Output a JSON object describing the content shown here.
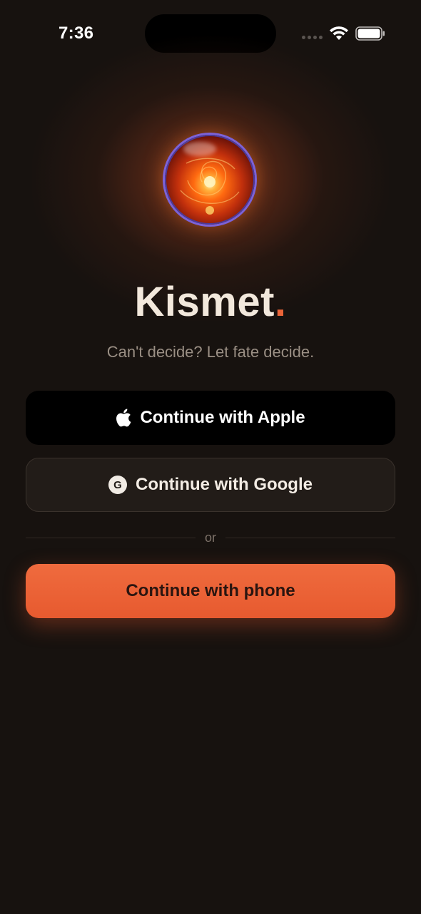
{
  "status_bar": {
    "time": "7:36"
  },
  "app": {
    "name": "Kismet",
    "name_dot": ".",
    "tagline": "Can't decide? Let fate decide."
  },
  "auth": {
    "apple_label": "Continue with Apple",
    "google_label": "Continue with Google",
    "google_badge": "G",
    "divider_text": "or",
    "phone_label": "Continue with phone"
  },
  "colors": {
    "background": "#17120f",
    "accent": "#e75a2f",
    "title": "#f2e8dc",
    "subtitle": "#9a8f84"
  },
  "icons": {
    "apple": "apple-icon",
    "google": "google-icon",
    "wifi": "wifi-icon",
    "battery": "battery-icon",
    "signal": "cellular-signal-icon",
    "orb": "crystal-orb-logo"
  }
}
